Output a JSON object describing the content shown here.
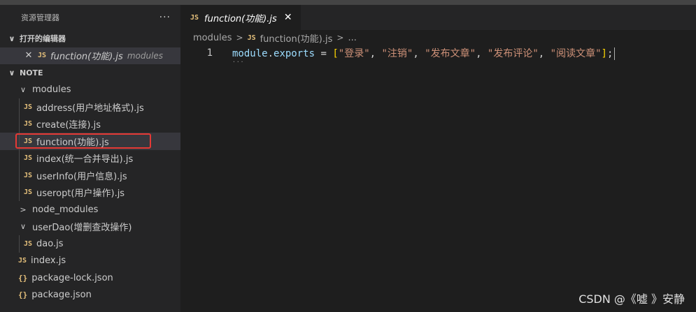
{
  "sidebar": {
    "title": "资源管理器",
    "more_icon": "···",
    "open_editors": {
      "label": "打开的编辑器",
      "items": [
        {
          "close": "✕",
          "icon": "JS",
          "name": "function(功能).js",
          "folder": "modules"
        }
      ]
    },
    "note": {
      "label": "NOTE",
      "modules": {
        "label": "modules",
        "files": [
          {
            "icon": "JS",
            "name": "address(用户地址格式).js"
          },
          {
            "icon": "JS",
            "name": "create(连接).js"
          },
          {
            "icon": "JS",
            "name": "function(功能).js"
          },
          {
            "icon": "JS",
            "name": "index(统一合并导出).js"
          },
          {
            "icon": "JS",
            "name": "userInfo(用户信息).js"
          },
          {
            "icon": "JS",
            "name": "useropt(用户操作).js"
          }
        ]
      },
      "node_modules": {
        "label": "node_modules"
      },
      "userDao": {
        "label": "userDao(增删查改操作)",
        "files": [
          {
            "icon": "JS",
            "name": "dao.js"
          }
        ]
      },
      "root_files": [
        {
          "icon": "JS",
          "name": "index.js"
        },
        {
          "icon": "{}",
          "name": "package-lock.json"
        },
        {
          "icon": "{}",
          "name": "package.json"
        }
      ]
    }
  },
  "editor": {
    "tab": {
      "icon": "JS",
      "label": "function(功能).js",
      "close": "✕"
    },
    "breadcrumb": {
      "folder": "modules",
      "sep": ">",
      "file_icon": "JS",
      "file": "function(功能).js",
      "tail": "..."
    },
    "lines": [
      {
        "number": "1",
        "tokens": {
          "t1": "module",
          "t2": ".",
          "t3": "exports",
          "t4": " = ",
          "t5": "[",
          "t6": "\"登录\"",
          "t7": ", ",
          "t8": "\"注销\"",
          "t9": ", ",
          "t10": "\"发布文章\"",
          "t11": ", ",
          "t12": "\"发布评论\"",
          "t13": ", ",
          "t14": "\"阅读文章\"",
          "t15": "]",
          "t16": ";"
        }
      }
    ]
  },
  "watermark": "CSDN @《嘘 》安静",
  "colors": {
    "accent_js": "#e5c07b",
    "highlight_box": "#e53935",
    "string": "#ce9178",
    "identifier": "#9cdcfe"
  }
}
